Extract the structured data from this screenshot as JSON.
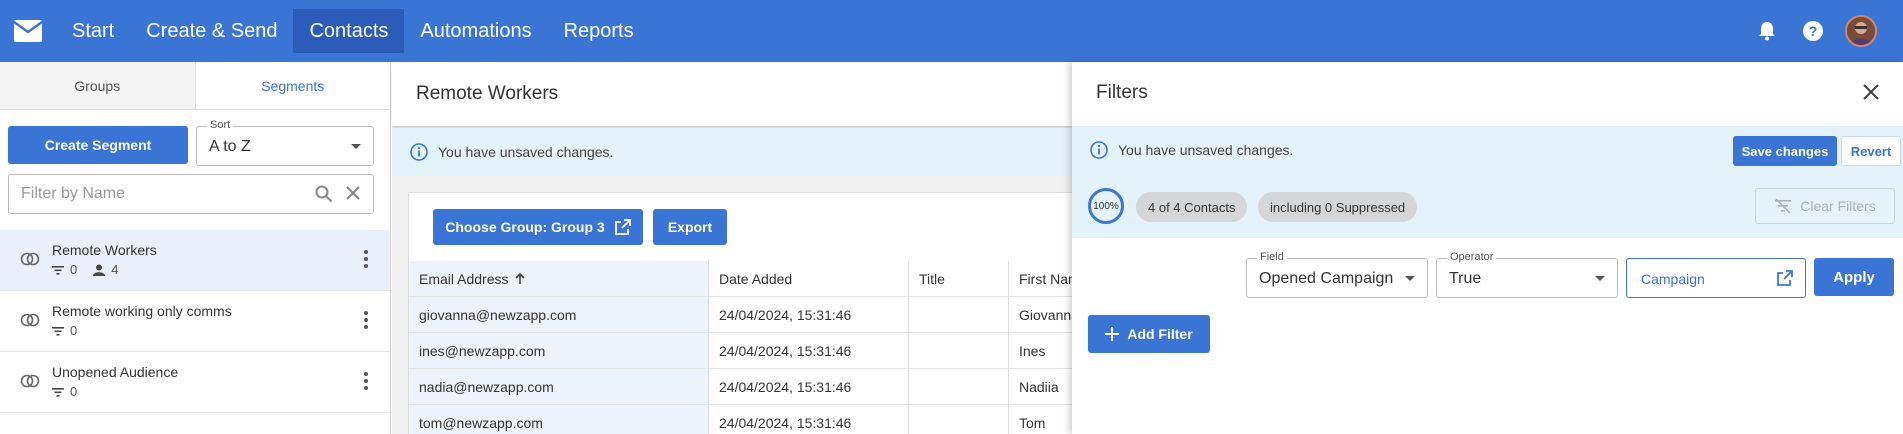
{
  "nav": {
    "items": [
      "Start",
      "Create & Send",
      "Contacts",
      "Automations",
      "Reports"
    ],
    "active_index": 2
  },
  "left": {
    "tabs": [
      "Groups",
      "Segments"
    ],
    "active_tab": 1,
    "create_label": "Create Segment",
    "sort": {
      "label": "Sort",
      "value": "A to Z"
    },
    "filter_placeholder": "Filter by Name",
    "segments": [
      {
        "name": "Remote Workers",
        "filter_count": "0",
        "contact_count": "4"
      },
      {
        "name": "Remote working only comms",
        "filter_count": "0"
      },
      {
        "name": "Unopened Audience",
        "filter_count": "0"
      }
    ]
  },
  "main": {
    "title": "Remote Workers",
    "notice": "You have unsaved changes.",
    "choose_group_label": "Choose Group: Group 3",
    "export_label": "Export",
    "columns": [
      "Email Address",
      "Date Added",
      "Title",
      "First Nam"
    ],
    "rows": [
      [
        "giovanna@newzapp.com",
        "24/04/2024, 15:31:46",
        "",
        "Giovanna"
      ],
      [
        "ines@newzapp.com",
        "24/04/2024, 15:31:46",
        "",
        "Ines"
      ],
      [
        "nadia@newzapp.com",
        "24/04/2024, 15:31:46",
        "",
        "Nadiia"
      ],
      [
        "tom@newzapp.com",
        "24/04/2024, 15:31:46",
        "",
        "Tom"
      ]
    ]
  },
  "filters": {
    "title": "Filters",
    "notice": "You have unsaved changes.",
    "save_label": "Save changes",
    "revert_label": "Revert",
    "percent": "100%",
    "contacts_chip": "4 of 4 Contacts",
    "suppressed_chip": "including 0 Suppressed",
    "clear_label": "Clear Filters",
    "field": {
      "label": "Field",
      "value": "Opened Campaign"
    },
    "operator": {
      "label": "Operator",
      "value": "True"
    },
    "campaign_label": "Campaign",
    "apply_label": "Apply",
    "add_filter_label": "Add Filter"
  },
  "colors": {
    "primary": "#3a75d6",
    "nav_active": "#2a5cb8",
    "notice_bg": "#e4f2fa"
  }
}
